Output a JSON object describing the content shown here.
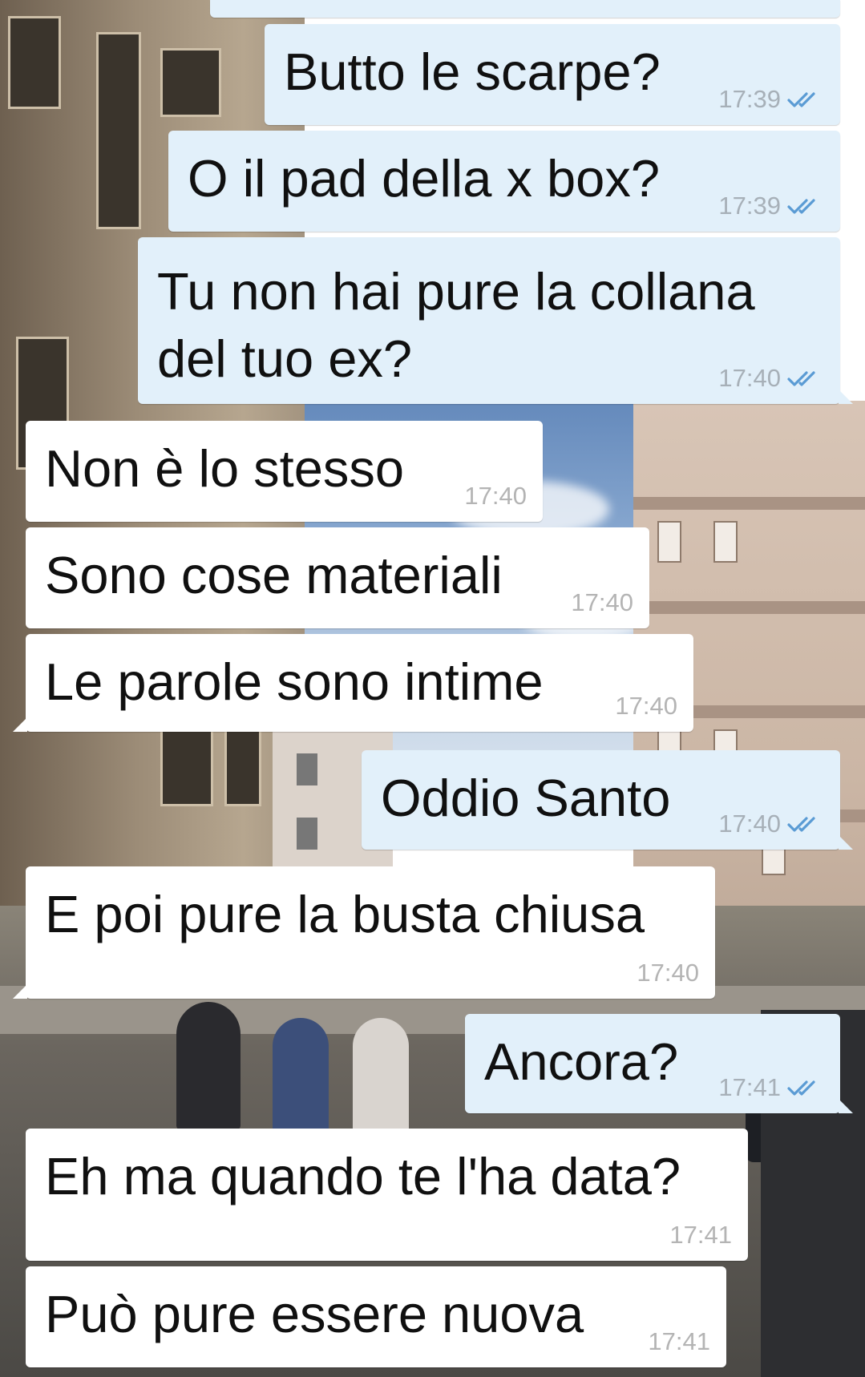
{
  "theme": {
    "outgoing_bubble": "#e2f0fa",
    "incoming_bubble": "#ffffff",
    "tick_color": "#5a9bd4",
    "time_color": "#a7b0b8"
  },
  "messages": [
    {
      "direction": "out",
      "text": "Butto le scarpe?",
      "time": "17:39",
      "status": "read-double-tick"
    },
    {
      "direction": "out",
      "text": "O il pad della x box?",
      "time": "17:39",
      "status": "read-double-tick"
    },
    {
      "direction": "out",
      "text": "Tu non hai pure la collana\ndel tuo ex?",
      "time": "17:40",
      "status": "read-double-tick"
    },
    {
      "direction": "in",
      "text": "Non è lo stesso",
      "time": "17:40"
    },
    {
      "direction": "in",
      "text": "Sono cose materiali",
      "time": "17:40"
    },
    {
      "direction": "in",
      "text": "Le parole sono intime",
      "time": "17:40"
    },
    {
      "direction": "out",
      "text": "Oddio Santo",
      "time": "17:40",
      "status": "read-double-tick"
    },
    {
      "direction": "in",
      "text": "E poi pure la busta chiusa",
      "time": "17:40"
    },
    {
      "direction": "out",
      "text": "Ancora?",
      "time": "17:41",
      "status": "read-double-tick"
    },
    {
      "direction": "in",
      "text": "Eh ma quando te l'ha data?",
      "time": "17:41"
    },
    {
      "direction": "in",
      "text": "Può pure essere nuova",
      "time": "17:41"
    }
  ]
}
